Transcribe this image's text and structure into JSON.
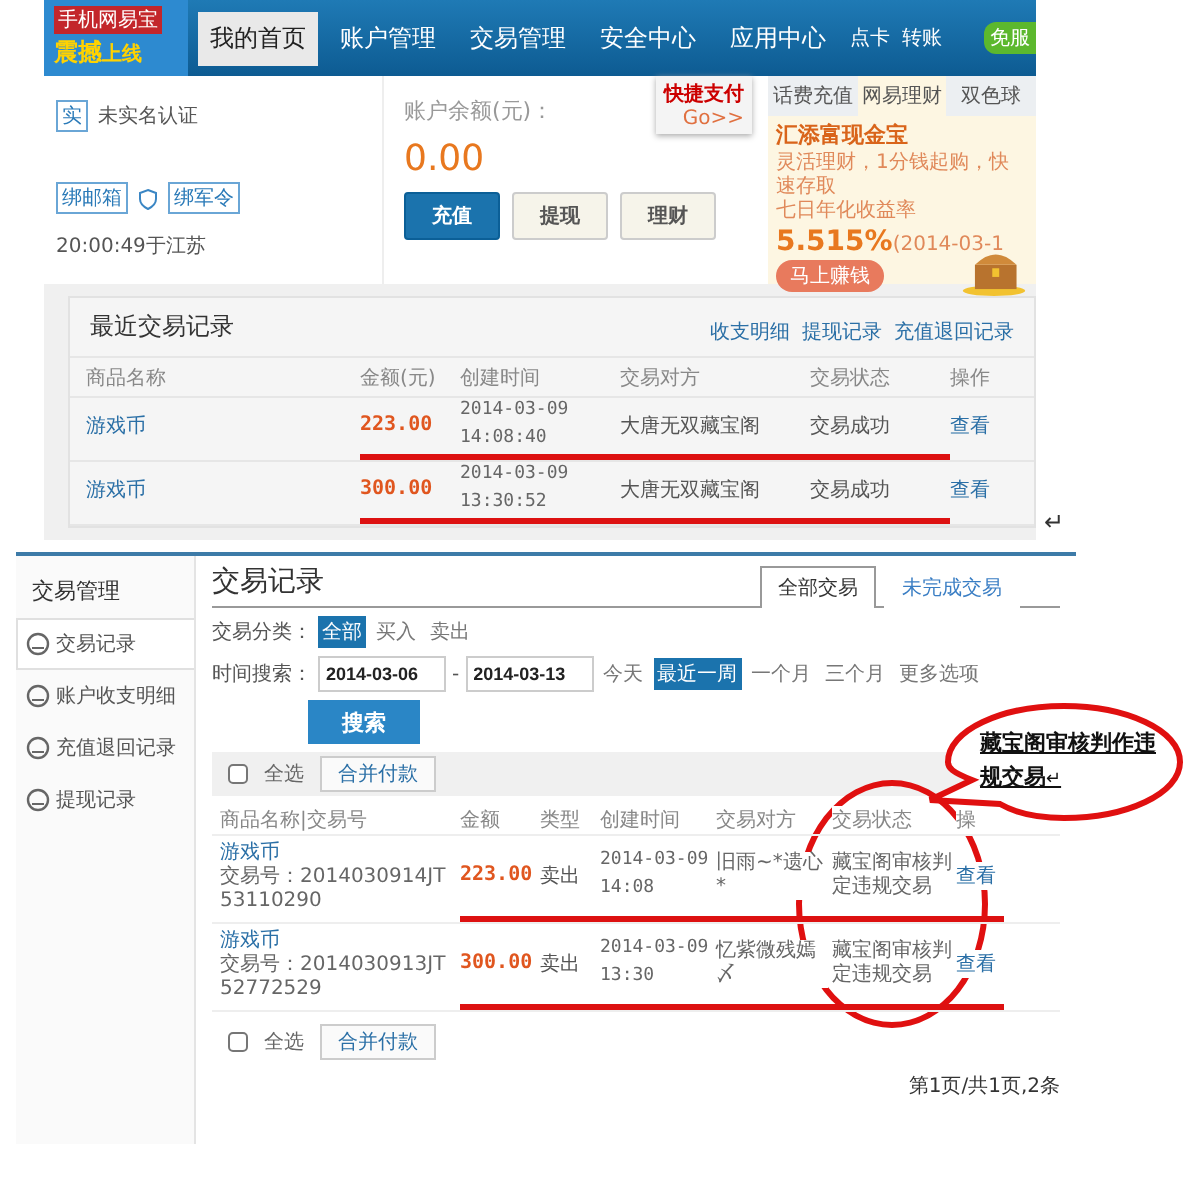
{
  "top_screen": {
    "logo": {
      "badge": "手机网易宝",
      "title": "震撼",
      "subtitle": "上线"
    },
    "nav": [
      {
        "label": "我的首页",
        "selected": true
      },
      {
        "label": "账户管理",
        "selected": false
      },
      {
        "label": "交易管理",
        "selected": false
      },
      {
        "label": "安全中心",
        "selected": false
      },
      {
        "label": "应用中心",
        "selected": false
      }
    ],
    "nav_links": [
      "点卡",
      "转账"
    ],
    "nav_badge": "免服",
    "account": {
      "verify_badge": "实",
      "verify": "未实名认证",
      "email": "绑邮箱",
      "token": "绑军令",
      "login": "20:00:49于江苏"
    },
    "balance": {
      "label": "账户余额(元)：",
      "amount": "0.00",
      "buttons": [
        {
          "label": "充值",
          "primary": true
        },
        {
          "label": "提现",
          "primary": false
        },
        {
          "label": "理财",
          "primary": false
        }
      ]
    },
    "sticker": {
      "title": "快捷支付",
      "link": "Go>>"
    },
    "promo": {
      "tabs": [
        {
          "label": "话费充值",
          "selected": false
        },
        {
          "label": "网易理财",
          "selected": true
        },
        {
          "label": "双色球",
          "selected": false
        }
      ],
      "title": "汇添富现金宝",
      "desc": "灵活理财，1分钱起购，快速存取",
      "rate_label": "七日年化收益率",
      "rate": "5.515%",
      "rate_date": "(2014-03-1",
      "button": "马上赚钱"
    },
    "recent": {
      "title": "最近交易记录",
      "links": [
        "收支明细",
        "提现记录",
        "充值退回记录"
      ],
      "columns": [
        "商品名称",
        "金额(元)",
        "创建时间",
        "交易对方",
        "交易状态",
        "操作"
      ],
      "rows": [
        {
          "name": "游戏币",
          "amount": "223.00",
          "date": "2014-03-09",
          "time": "14:08:40",
          "party": "大唐无双藏宝阁",
          "status": "交易成功",
          "action": "查看",
          "marked": true
        },
        {
          "name": "游戏币",
          "amount": "300.00",
          "date": "2014-03-09",
          "time": "13:30:52",
          "party": "大唐无双藏宝阁",
          "status": "交易成功",
          "action": "查看",
          "marked": true
        }
      ]
    }
  },
  "return_mark": "↵",
  "bottom_screen": {
    "sidebar": {
      "title": "交易管理",
      "items": [
        {
          "label": "交易记录",
          "selected": true
        },
        {
          "label": "账户收支明细",
          "selected": false
        },
        {
          "label": "充值退回记录",
          "selected": false
        },
        {
          "label": "提现记录",
          "selected": false
        }
      ]
    },
    "title": "交易记录",
    "tabs": [
      {
        "label": "全部交易",
        "selected": true
      },
      {
        "label": "未完成交易",
        "selected": false
      }
    ],
    "category": {
      "label": "交易分类：",
      "options": [
        {
          "label": "全部",
          "selected": true
        },
        {
          "label": "买入",
          "selected": false
        },
        {
          "label": "卖出",
          "selected": false
        }
      ]
    },
    "time": {
      "label": "时间搜索：",
      "from": "2014-03-06",
      "separator": "-",
      "to": "2014-03-13",
      "ranges": [
        {
          "label": "今天",
          "selected": false
        },
        {
          "label": "最近一周",
          "selected": true
        },
        {
          "label": "一个月",
          "selected": false
        },
        {
          "label": "三个月",
          "selected": false
        }
      ],
      "more": "更多选项"
    },
    "search_button": "搜索",
    "top_bar": {
      "select_all": "全选",
      "checked": false,
      "merge_button": "合并付款"
    },
    "columns": [
      "商品名称|交易号",
      "金额",
      "类型",
      "创建时间",
      "交易对方",
      "交易状态",
      "操"
    ],
    "rows": [
      {
        "name": "游戏币",
        "trade_no": "交易号：2014030914JT53110290",
        "amount": "223.00",
        "type": "卖出",
        "date": "2014-03-09",
        "time": "14:08",
        "party": "旧雨~*遗心*",
        "status": "藏宝阁审核判定违规交易",
        "action": "查看",
        "marked": true
      },
      {
        "name": "游戏币",
        "trade_no": "交易号：2014030913JT52772529",
        "amount": "300.00",
        "type": "卖出",
        "date": "2014-03-09",
        "time": "13:30",
        "party": "忆紫微残嫣〆",
        "status": "藏宝阁审核判定违规交易",
        "action": "查看",
        "marked": true
      }
    ],
    "bottom_bar": {
      "select_all": "全选",
      "checked": false,
      "merge_button": "合并付款"
    },
    "pagination": "第1页/共1页,2条"
  },
  "annotation": {
    "text": "藏宝阁审核判作违规交易",
    "return_mark": "↵"
  }
}
